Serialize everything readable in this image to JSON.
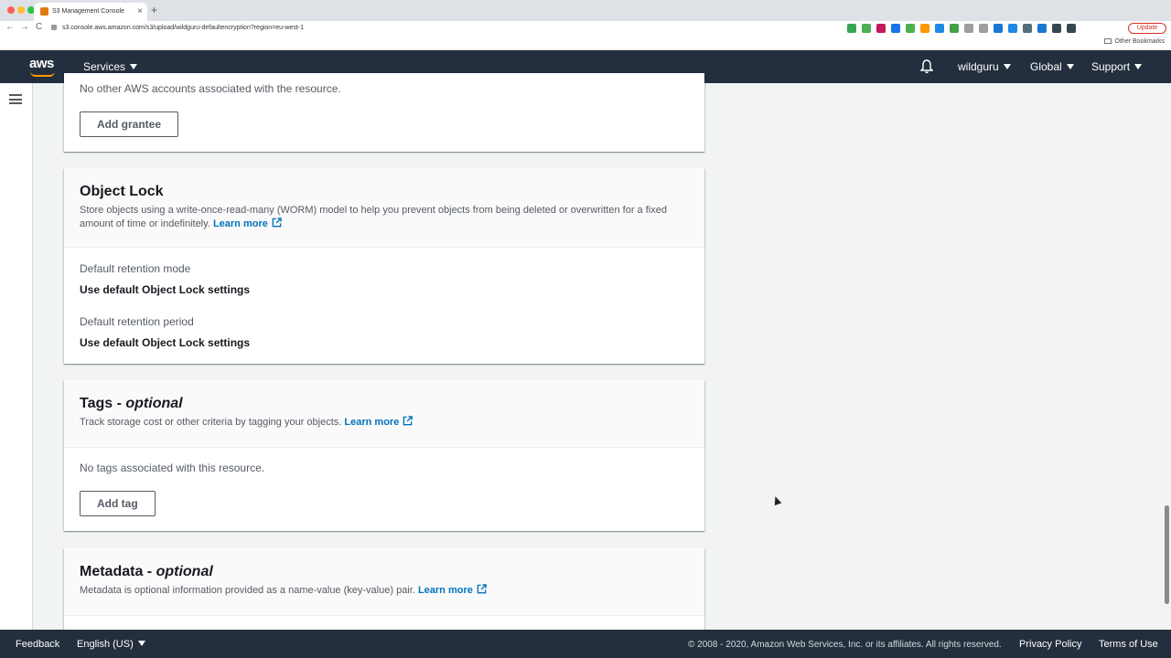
{
  "browser": {
    "tab_title": "S3 Management Console",
    "tab_close": "×",
    "new_tab": "+",
    "url": "s3.console.aws.amazon.com/s3/upload/wildguru-defaultencryption?region=eu-west-1",
    "back": "←",
    "forward": "→",
    "reload": "C",
    "update_label": "Update",
    "other_bookmarks": "Other Bookmarks",
    "extension_colors": [
      "#34a853",
      "#4caf50",
      "#c2185b",
      "#1a73e8",
      "#4caf50",
      "#ff9800",
      "#1e88e5",
      "#43a047",
      "#9e9e9e",
      "#9e9e9e",
      "#1976d2",
      "#1e88e5",
      "#546e7a",
      "#1976d2",
      "#37474f",
      "#37474f"
    ]
  },
  "header": {
    "logo": "aws",
    "services": "Services",
    "account": "wildguru",
    "region": "Global",
    "support": "Support"
  },
  "acl_panel": {
    "no_accounts_text": "No other AWS accounts associated with the resource.",
    "add_grantee": "Add grantee"
  },
  "object_lock": {
    "title": "Object Lock",
    "description": "Store objects using a write-once-read-many (WORM) model to help you prevent objects from being deleted or overwritten for a fixed amount of time or indefinitely.",
    "learn_more": "Learn more",
    "retention_mode_label": "Default retention mode",
    "retention_mode_value": "Use default Object Lock settings",
    "retention_period_label": "Default retention period",
    "retention_period_value": "Use default Object Lock settings"
  },
  "tags": {
    "title": "Tags - ",
    "title_optional": "optional",
    "description": "Track storage cost or other criteria by tagging your objects.",
    "learn_more": "Learn more",
    "empty_text": "No tags associated with this resource.",
    "add_tag": "Add tag"
  },
  "metadata": {
    "title": "Metadata - ",
    "title_optional": "optional",
    "description": "Metadata is optional information provided as a name-value (key-value) pair.",
    "learn_more": "Learn more"
  },
  "footer": {
    "feedback": "Feedback",
    "language": "English (US)",
    "copyright": "© 2008 - 2020, Amazon Web Services, Inc. or its affiliates. All rights reserved.",
    "privacy": "Privacy Policy",
    "terms": "Terms of Use"
  },
  "colors": {
    "aws_navy": "#232f3e",
    "link_blue": "#0073bb",
    "aws_orange": "#ff9900"
  }
}
